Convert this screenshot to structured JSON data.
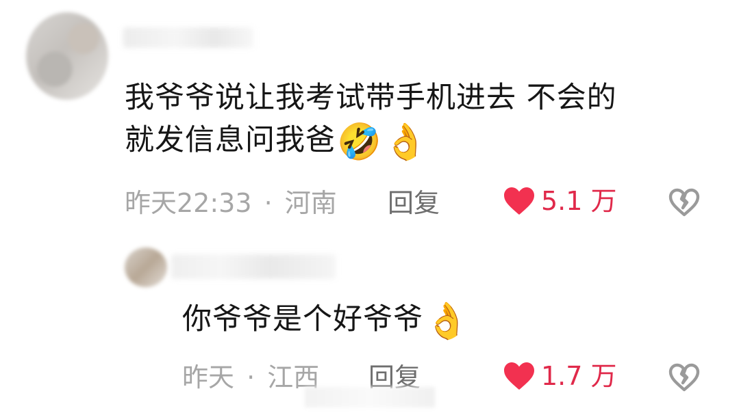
{
  "comment": {
    "text_line1": "我爷爷说让我考试带手机进去 不会的",
    "text_line2": "就发信息问我爸",
    "emoji1": "🤣",
    "emoji2": "👌",
    "time": "昨天22:33",
    "separator": "·",
    "location": "河南",
    "reply_label": "回复",
    "like_count": "5.1 万"
  },
  "reply": {
    "text": "你爷爷是个好爷爷",
    "emoji": "👌",
    "time": "昨天",
    "separator": "·",
    "location": "江西",
    "reply_label": "回复",
    "like_count": "1.7 万"
  },
  "colors": {
    "like": "#f23150",
    "meta": "#a6a6a6",
    "text": "#161616"
  }
}
